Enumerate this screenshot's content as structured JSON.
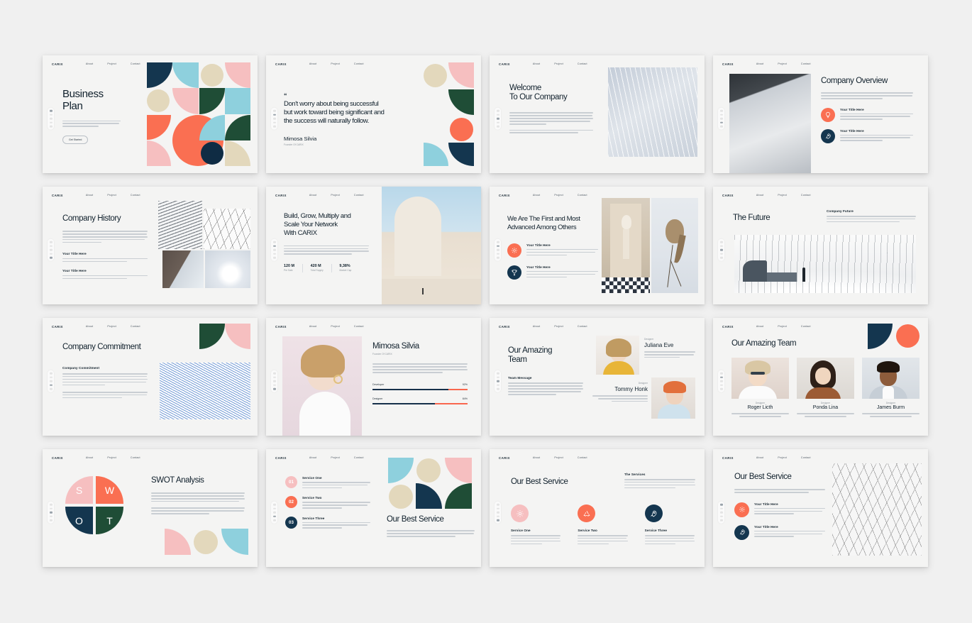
{
  "palette": {
    "navy": "#14364f",
    "navy_deep": "#0f2c44",
    "teal": "#8ed0dd",
    "sand": "#e3d8bc",
    "pink": "#f6bfc0",
    "coral": "#fa6f52",
    "green": "#1f4d36",
    "ink": "#10202c",
    "bg": "#f4f4f3",
    "page_bg": "#f0f0f0"
  },
  "nav": {
    "logo": "CARIX",
    "links": [
      "About",
      "Project",
      "Contact"
    ]
  },
  "lorem": {
    "short": "Sit amet consectetur adipiscing elit duis. Cursus eget nunc scelerisque viverra mauris in aliquam sem fringilla.",
    "medium": "Sit amet consectetur adipiscing elit duis. Cursus eget nunc scelerisque viverra mauris in aliquam sem fringilla. Lorem donec massa sapien faucibus sit.",
    "long": "Sit amet consectetur adipiscing elit duis. Cursus eget nunc scelerisque viverra mauris in aliquam sem fringilla. Lorem donec massa sapien faucibus sit. Sit enim porta non pulvinar neque laoreet suspendisse interdum."
  },
  "slides": [
    {
      "id": "title",
      "title_line1": "Business",
      "title_line2": "Plan",
      "cta": "Get Started"
    },
    {
      "id": "quote",
      "quote_mark": "“",
      "quote_l1": "Don't worry about being successful",
      "quote_l2": "but work toward being significant and",
      "quote_l3": "the success will naturally follow.",
      "author": "Mimosa Silvia",
      "author_role": "Founder Of CARIX"
    },
    {
      "id": "welcome",
      "title_line1": "Welcome",
      "title_line2": "To Our Company"
    },
    {
      "id": "company-overview",
      "title": "Company Overview",
      "features": [
        {
          "title": "Your Title Here",
          "icon": "lightbulb-icon",
          "color": "#fa6f52"
        },
        {
          "title": "Your Title Here",
          "icon": "rocket-icon",
          "color": "#14364f"
        }
      ]
    },
    {
      "id": "company-history",
      "title": "Company History",
      "features": [
        {
          "title": "Your Title Here"
        },
        {
          "title": "Your Title Here"
        }
      ]
    },
    {
      "id": "build-grow",
      "title_line1": "Build, Grow, Multiply and",
      "title_line2": "Scale Your Network",
      "title_line3": "With CARIX",
      "stats": [
        {
          "value": "120 M",
          "label": "Pre Sale"
        },
        {
          "value": "420 M",
          "label": "Total Supply"
        },
        {
          "value": "9,38%",
          "label": "Market Cap"
        }
      ]
    },
    {
      "id": "first-advanced",
      "title_line1": "We Are The First and Most",
      "title_line2": "Advanced Among Others",
      "features": [
        {
          "title": "Your Title Here",
          "icon": "gear-icon",
          "color": "#fa6f52"
        },
        {
          "title": "Your Title Here",
          "icon": "trophy-icon",
          "color": "#14364f"
        }
      ]
    },
    {
      "id": "the-future",
      "title": "The Future",
      "side_heading": "Company Future"
    },
    {
      "id": "company-commitment",
      "title": "Company Commitment",
      "section_heading": "Company Commitment"
    },
    {
      "id": "profile",
      "name": "Mimosa Silvia",
      "role": "Founder Of CARIX",
      "skills": [
        {
          "label": "Developer",
          "value": "92%",
          "percent": 92
        },
        {
          "label": "Designer",
          "value": "84%",
          "percent": 84
        }
      ]
    },
    {
      "id": "amazing-team",
      "title_line1": "Our Amazing",
      "title_line2": "Team",
      "message_heading": "Team Message",
      "members": [
        {
          "role": "Designer",
          "name": "Juliana Eve"
        },
        {
          "role": "Designer",
          "name": "Tommy Honk"
        }
      ]
    },
    {
      "id": "team-grid",
      "title": "Our Amazing Team",
      "members": [
        {
          "role": "Designer",
          "name": "Roger Licth"
        },
        {
          "role": "Designer",
          "name": "Ponda Lina"
        },
        {
          "role": "Designer",
          "name": "James Burm"
        }
      ]
    },
    {
      "id": "swot",
      "title": "SWOT Analysis",
      "quadrants": [
        {
          "letter": "S",
          "color": "#f6bfc0"
        },
        {
          "letter": "W",
          "color": "#fa6f52"
        },
        {
          "letter": "O",
          "color": "#14364f"
        },
        {
          "letter": "T",
          "color": "#1f4d36"
        }
      ]
    },
    {
      "id": "services-numbered",
      "title": "Our Best Service",
      "items": [
        {
          "num": "01",
          "title": "Service One",
          "color": "#f6bfc0"
        },
        {
          "num": "02",
          "title": "Service Two",
          "color": "#fa6f52"
        },
        {
          "num": "03",
          "title": "Service Three",
          "color": "#14364f"
        }
      ]
    },
    {
      "id": "services-columns",
      "title": "Our Best Service",
      "side_heading": "The Services",
      "items": [
        {
          "title": "Service One",
          "icon": "gear-icon",
          "color": "#f6bfc0"
        },
        {
          "title": "Service Two",
          "icon": "recycle-icon",
          "color": "#fa6f52"
        },
        {
          "title": "Service Three",
          "icon": "rocket-icon",
          "color": "#14364f"
        }
      ]
    },
    {
      "id": "best-service-mesh",
      "title": "Our Best Service",
      "features": [
        {
          "title": "Your Title Here",
          "icon": "gear-icon",
          "color": "#fa6f52"
        },
        {
          "title": "Your Title Here",
          "icon": "rocket-icon",
          "color": "#14364f"
        }
      ]
    }
  ]
}
